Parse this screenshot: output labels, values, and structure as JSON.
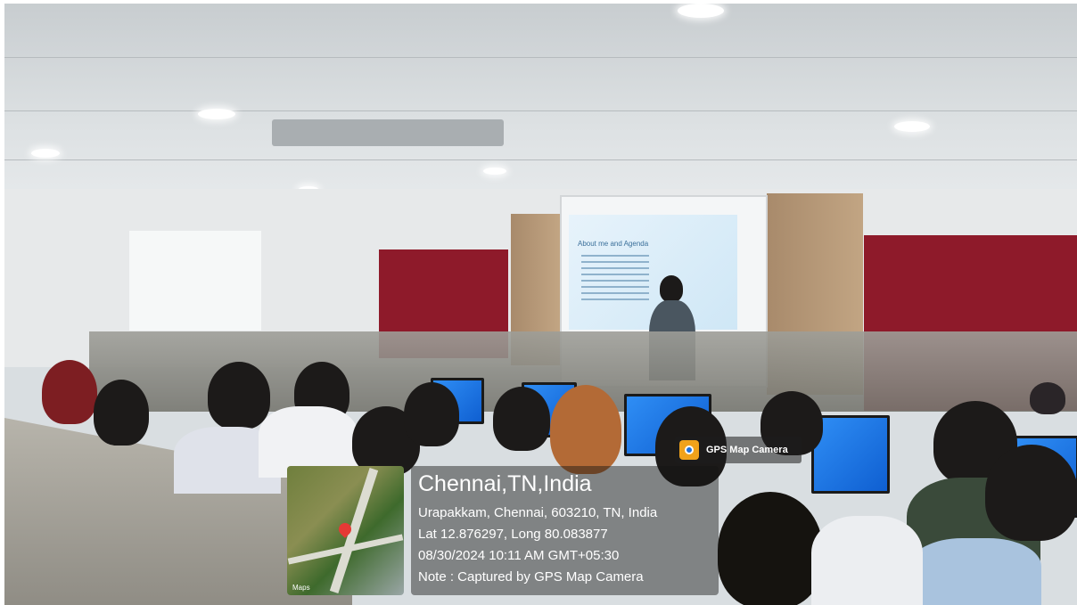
{
  "gps_stamp": {
    "app_name": "GPS Map Camera",
    "map_label": "Maps",
    "place_title": "Chennai,TN,India",
    "address": "Urapakkam, Chennai, 603210, TN, India",
    "coordinates": "Lat 12.876297, Long 80.083877",
    "timestamp": "08/30/2024 10:11 AM GMT+05:30",
    "note": "Note : Captured by GPS Map Camera",
    "icon": "gps-map-camera-icon",
    "pin_icon": "location-pin-icon"
  },
  "slide": {
    "title": "About me and Agenda"
  },
  "colors": {
    "board": "#8e1a2a",
    "monitor_screen": "#2f8ef5",
    "overlay": "#141414"
  }
}
